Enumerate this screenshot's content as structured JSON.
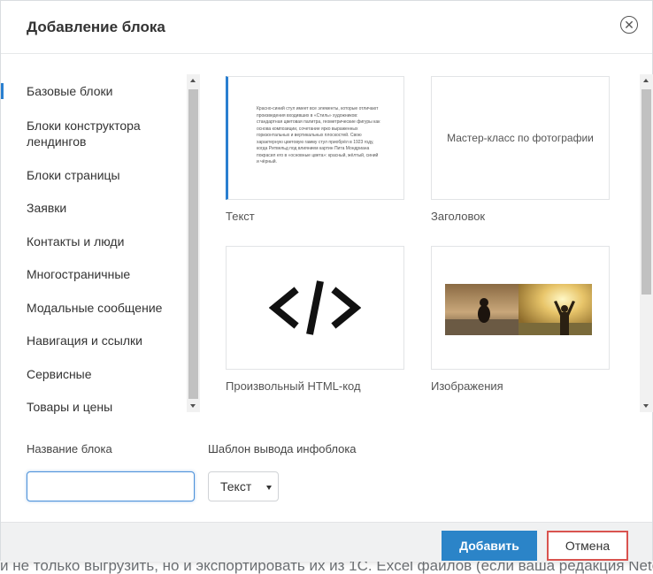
{
  "dialog": {
    "title": "Добавление блока"
  },
  "sidebar": {
    "items": [
      {
        "label": "Базовые блоки",
        "active": true
      },
      {
        "label": "Блоки конструктора лендингов"
      },
      {
        "label": "Блоки страницы"
      },
      {
        "label": "Заявки"
      },
      {
        "label": "Контакты и люди"
      },
      {
        "label": "Многостраничные"
      },
      {
        "label": "Модальные сообщение"
      },
      {
        "label": "Навигация и ссылки"
      },
      {
        "label": "Сервисные"
      },
      {
        "label": "Товары и цены"
      }
    ]
  },
  "blocks": [
    {
      "label": "Текст",
      "preview_text": "Красно-синий стул имеет все элементы, которые отличают произведения входивших в «Стиль» художников: стандартная цветовая палитра, геометрические фигуры как основа композиции, сочетание ярко выраженных горизонтальных и вертикальных плоскостей. Свою характерную цветовую гамму стул приобрёл в 1923 году, когда Ритвельд под влиянием картин Пита Мондриана покрасил его в «основные цвета»: красный, жёлтый, синий и чёрный.",
      "selected": true
    },
    {
      "label": "Заголовок",
      "preview_text": "Мастер-класс по фотографии"
    },
    {
      "label": "Произвольный HTML-код",
      "icon": "code-icon"
    },
    {
      "label": "Изображения",
      "icon": "images-icon"
    }
  ],
  "form": {
    "name_label": "Название блока",
    "name_value": "",
    "template_label": "Шаблон вывода инфоблока",
    "template_value": "Текст"
  },
  "footer": {
    "add_label": "Добавить",
    "cancel_label": "Отмена"
  },
  "background": {
    "text": "и не только выгрузить, но и экспортировать их из 1С. Excel файлов (если ваша редакция Netcat"
  },
  "colors": {
    "accent": "#2a7fd0",
    "add_button": "#2b84c8",
    "cancel_border": "#d9534f"
  }
}
